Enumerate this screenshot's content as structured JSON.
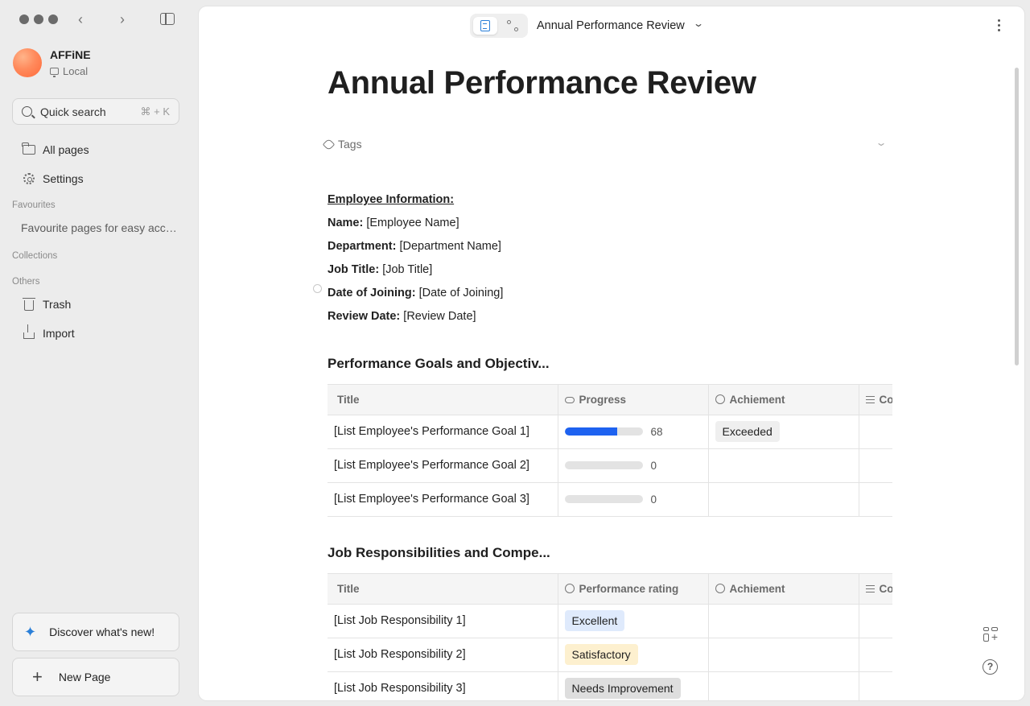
{
  "sidebar": {
    "workspace": {
      "name": "AFFiNE",
      "storage": "Local"
    },
    "quick_search": {
      "label": "Quick search",
      "shortcut": "⌘ + K"
    },
    "nav": [
      {
        "label": "All pages",
        "icon": "folder-icon"
      },
      {
        "label": "Settings",
        "icon": "gear-icon"
      }
    ],
    "favourites_label": "Favourites",
    "favourites_hint": "Favourite pages for easy access",
    "collections_label": "Collections",
    "others_label": "Others",
    "others": [
      {
        "label": "Trash",
        "icon": "trash-icon"
      },
      {
        "label": "Import",
        "icon": "import-icon"
      }
    ],
    "discover_label": "Discover what's new!",
    "new_page_label": "New Page"
  },
  "header": {
    "doc_title": "Annual Performance Review"
  },
  "doc": {
    "title": "Annual Performance Review",
    "tags_label": "Tags",
    "employee_heading": "Employee Information:",
    "fields": [
      {
        "label": "Name:",
        "value": "[Employee Name]"
      },
      {
        "label": "Department:",
        "value": "[Department Name]"
      },
      {
        "label": "Job Title:",
        "value": "[Job Title]"
      },
      {
        "label": "Date of Joining:",
        "value": "[Date of Joining]"
      },
      {
        "label": "Review Date:",
        "value": "[Review Date]"
      }
    ],
    "goals": {
      "heading": "Performance Goals and Objectiv...",
      "columns": [
        "Title",
        "Progress",
        "Achiement",
        "Co"
      ],
      "rows": [
        {
          "title": "[List Employee's Performance Goal 1]",
          "progress": 68,
          "achievement": "Exceeded"
        },
        {
          "title": "[List Employee's Performance Goal 2]",
          "progress": 0,
          "achievement": ""
        },
        {
          "title": "[List Employee's Performance Goal 3]",
          "progress": 0,
          "achievement": ""
        }
      ]
    },
    "responsibilities": {
      "heading": "Job Responsibilities and Compe...",
      "columns": [
        "Title",
        "Performance rating",
        "Achiement",
        "Co"
      ],
      "rows": [
        {
          "title": "[List Job Responsibility 1]",
          "rating": "Excellent",
          "rating_color": "#dfeafc"
        },
        {
          "title": "[List Job Responsibility 2]",
          "rating": "Satisfactory",
          "rating_color": "#fdf0cf"
        },
        {
          "title": "[List Job Responsibility 3]",
          "rating": "Needs Improvement",
          "rating_color": "#dedede"
        }
      ]
    }
  },
  "colors": {
    "accent": "#1e62f0",
    "exceeded_pill": "#efefef"
  }
}
